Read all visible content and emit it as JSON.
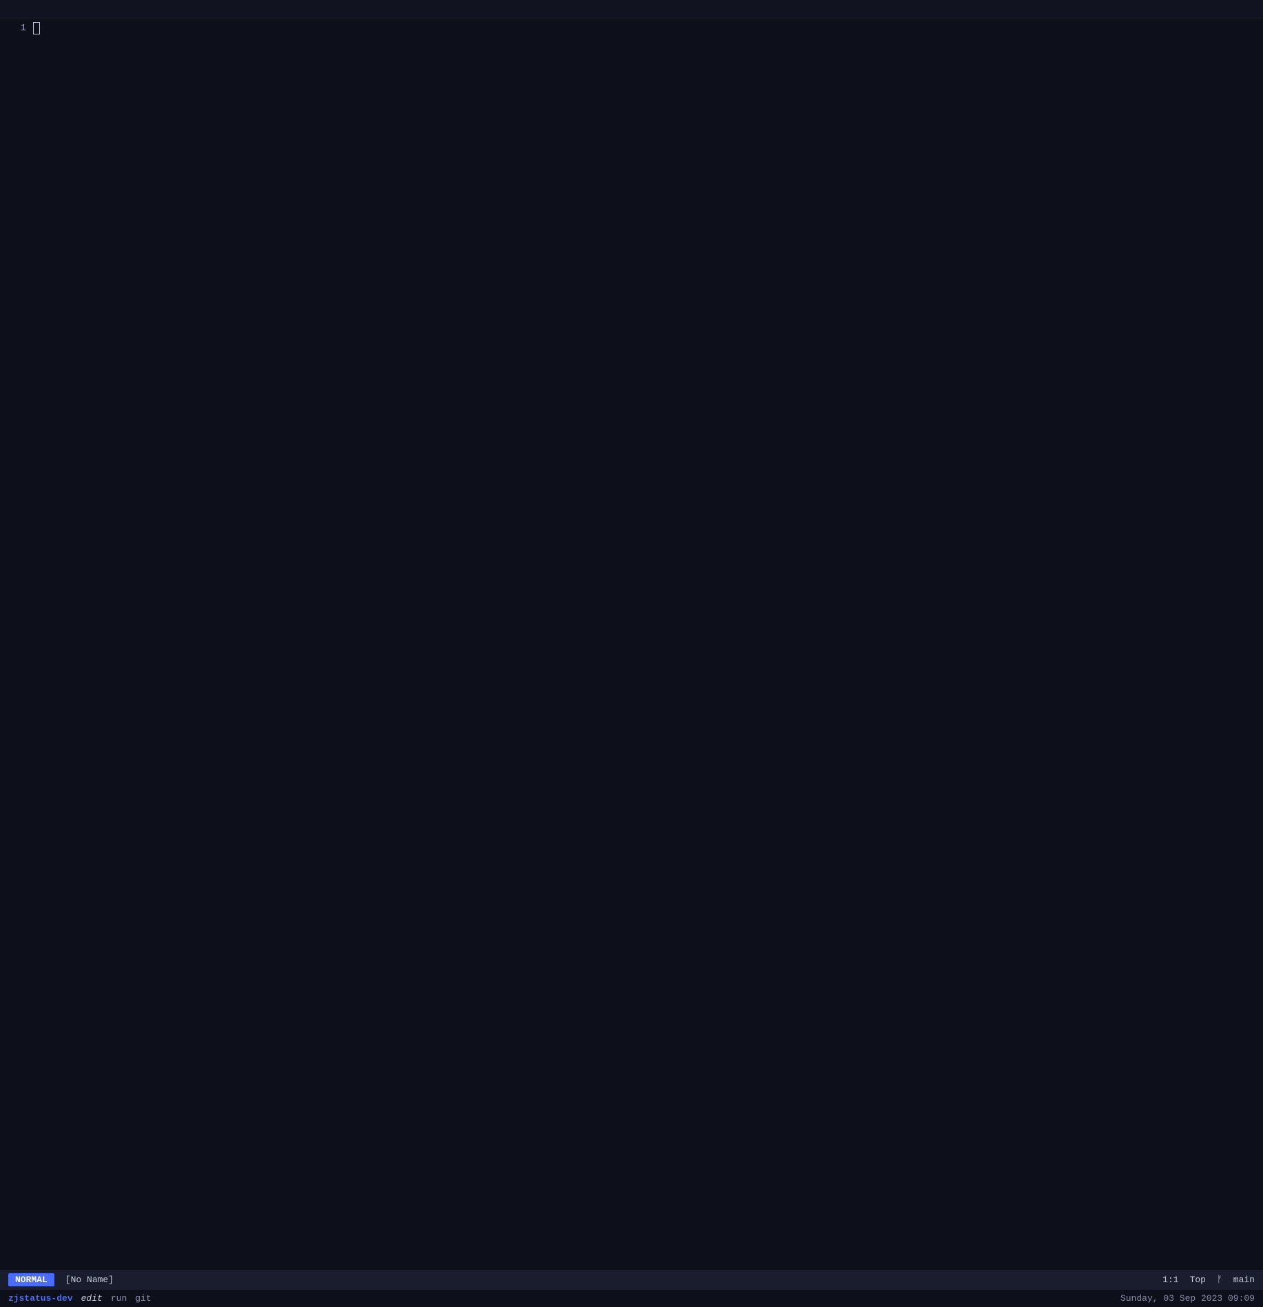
{
  "tab_bar": {
    "tabs": []
  },
  "editor": {
    "line_number": "1",
    "cursor_visible": true
  },
  "status_bar_1": {
    "mode": "NORMAL",
    "filename": "[No Name]",
    "position": "1:1",
    "scroll_position": "Top",
    "git_icon": "ᚠ",
    "branch": "main"
  },
  "status_bar_2": {
    "app_name": "zjstatus-dev",
    "edit_label": "edit",
    "run_label": "run",
    "git_label": "git",
    "datetime": "Sunday, 03 Sep 2023 09:09"
  }
}
